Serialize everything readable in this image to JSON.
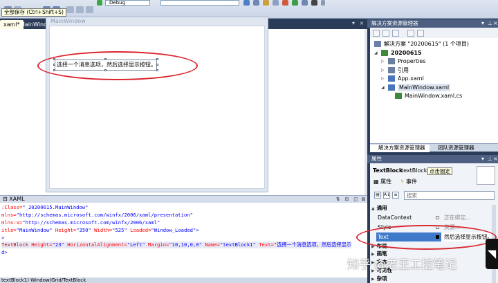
{
  "toolbar": {
    "config_value": "Debug",
    "tooltip": "全部保存 (Ctrl+Shift+S)"
  },
  "tabs": [
    {
      "label": "xaml*"
    },
    {
      "label": "MainWindow.xaml.cs*"
    }
  ],
  "designer": {
    "window_title": "MainWindow",
    "textblock_text": "选择一个消息选项，然后选择显示按钮。"
  },
  "xaml_pane": {
    "label": "XAML",
    "lines": [
      {
        "parts": [
          {
            "t": "attr",
            "v": ":Class="
          },
          {
            "t": "val",
            "v": "\"_20200615.MainWindow\""
          }
        ]
      },
      {
        "parts": [
          {
            "t": "attr",
            "v": "mlns="
          },
          {
            "t": "val",
            "v": "\"http://schemas.microsoft.com/winfx/2006/xaml/presentation\""
          }
        ]
      },
      {
        "parts": [
          {
            "t": "attr",
            "v": "mlns:x="
          },
          {
            "t": "val",
            "v": "\"http://schemas.microsoft.com/winfx/2006/xaml\""
          }
        ]
      },
      {
        "parts": [
          {
            "t": "attr",
            "v": "itle="
          },
          {
            "t": "val",
            "v": "\"MainWindow\""
          },
          {
            "t": "attr",
            "v": " Height="
          },
          {
            "t": "val",
            "v": "\"350\""
          },
          {
            "t": "attr",
            "v": " Width="
          },
          {
            "t": "val",
            "v": "\"525\""
          },
          {
            "t": "attr",
            "v": " Loaded="
          },
          {
            "t": "val",
            "v": "\"Window_Loaded\""
          },
          {
            "t": "val",
            "v": ">"
          }
        ]
      },
      {
        "parts": [
          {
            "t": "val",
            "v": ">"
          }
        ]
      },
      {
        "parts": [
          {
            "t": "tag",
            "v": "TextBlock"
          },
          {
            "t": "attr",
            "v": " Height="
          },
          {
            "t": "val",
            "v": "\"23\""
          },
          {
            "t": "attr",
            "v": " HorizontalAlignment="
          },
          {
            "t": "val",
            "v": "\"Left\""
          },
          {
            "t": "attr",
            "v": " Margin="
          },
          {
            "t": "val",
            "v": "\"10,10,0,0\""
          },
          {
            "t": "attr",
            "v": " Name="
          },
          {
            "t": "val",
            "v": "\"textBlock1\""
          },
          {
            "t": "attr",
            "v": " Text="
          },
          {
            "t": "val",
            "v": "\"选择一个消息选项，然后选择显示"
          }
        ]
      },
      {
        "parts": [
          {
            "t": "val",
            "v": "d>"
          }
        ]
      }
    ],
    "status": "textBlock1)   Window/Grid/TextBlock"
  },
  "solution_explorer": {
    "title": "解决方案资源管理器",
    "tree": [
      {
        "label": "解决方案 \"20200615\" (1 个项目)",
        "icon": "solution-icon",
        "indent": 0,
        "expander": ""
      },
      {
        "label": "20200615",
        "icon": "csharp-project-icon",
        "indent": 1,
        "expander": "open",
        "bold": true
      },
      {
        "label": "Properties",
        "icon": "properties-folder-icon",
        "indent": 2,
        "expander": "closed"
      },
      {
        "label": "引用",
        "icon": "references-folder-icon",
        "indent": 2,
        "expander": "closed"
      },
      {
        "label": "App.xaml",
        "icon": "xaml-file-icon",
        "indent": 2,
        "expander": "closed"
      },
      {
        "label": "MainWindow.xaml",
        "icon": "xaml-file-icon",
        "indent": 2,
        "expander": "open",
        "selected": true
      },
      {
        "label": "MainWindow.xaml.cs",
        "icon": "cs-file-icon",
        "indent": 3,
        "expander": ""
      }
    ],
    "bottom_tabs": [
      "解决方案资源管理器",
      "团队资源管理器"
    ]
  },
  "properties": {
    "title": "属性",
    "type": "TextBlock",
    "name": "textBlock1",
    "tooltip": "点击固定",
    "tab_properties": "属性",
    "tab_events": "事件",
    "search_placeholder": "搜索",
    "categories": [
      {
        "label": "通用",
        "expanded": true
      },
      {
        "label": "布局",
        "expanded": false
      },
      {
        "label": "画笔",
        "expanded": false
      },
      {
        "label": "文本",
        "expanded": false
      },
      {
        "label": "可见性",
        "expanded": false
      },
      {
        "label": "杂项",
        "expanded": false
      }
    ],
    "rows": [
      {
        "name": "DataContext",
        "value": "正在绑定..."
      },
      {
        "name": "Style",
        "value": "资源..."
      },
      {
        "name": "Text",
        "value": "然后选择显示按钮。",
        "selected": true
      }
    ]
  },
  "watermark": "知乎 @老王工控笔记",
  "colors": {
    "ide_background": "#2b3c59",
    "annotation_red": "#d9262f",
    "selection_blue": "#3f79c9"
  }
}
